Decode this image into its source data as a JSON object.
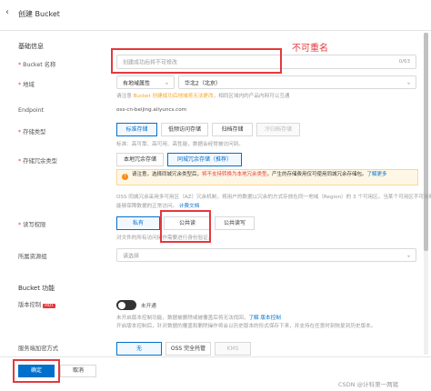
{
  "header": {
    "title": "创建 Bucket"
  },
  "basic_info": {
    "section_title": "基础信息"
  },
  "bucket_name": {
    "label": "Bucket 名称",
    "placeholder": "创建成功后将不可修改",
    "counter": "0/63"
  },
  "annotation": {
    "text": "不可重名"
  },
  "region": {
    "label": "地域",
    "type_value": "有地域属性",
    "region_value": "华北2（北京）",
    "hint_prefix": "请注意 ",
    "hint_orange": "Bucket 创建成功后地域将无法更改",
    "hint_suffix": "，相同区域内的产品内网可以互通"
  },
  "endpoint": {
    "label": "Endpoint",
    "value": "oss-cn-beijing.aliyuncs.com"
  },
  "storage_type": {
    "label": "存储类型",
    "options": [
      "标准存储",
      "低频访问存储",
      "归档存储",
      "冷归档存储"
    ],
    "hint": "标准：高可靠、高可用、高性能，数据会经常被访问到。"
  },
  "redundancy": {
    "label": "存储冗余类型",
    "options": [
      "本地冗余存储",
      "同城冗余存储（推荐）"
    ],
    "warning_prefix": "请注意，选择同城冗余类型后，",
    "warning_red": "将不支持转换为本地冗余类型",
    "warning_suffix": "。产生的存储费用仅可使用同城冗余存储包。",
    "warning_link": "了解更多",
    "hint_line1": "OSS 同城冗余采用多可用区（AZ）冗余机制，将用户的数据以冗余的方式存放在同一地域（Region）的 3 个可用区。当某个可用区不可用时，仍然",
    "hint_line2": "能够保障数据的正常访问。",
    "hint_link": "计费文档"
  },
  "acl": {
    "label": "读写权限",
    "options": [
      "私有",
      "公共读",
      "公共读写"
    ],
    "hint": "对文件的所有访问操作需要进行身份验证。"
  },
  "resource_group": {
    "label": "所属资源组",
    "placeholder": "请选择"
  },
  "bucket_features": {
    "section_title": "Bucket 功能"
  },
  "versioning": {
    "label": "版本控制",
    "badge": "HOT",
    "status": "未开通",
    "hint1_prefix": "未开启版本控制功能，数据被删除或被覆盖后将无法找回，",
    "hint1_link": "了解 版本控制",
    "hint2": "开启版本控制后，针对数据的覆盖和删除操作将会以历史版本的形式保存下来，并支持在任意时刻恢复到历史版本。"
  },
  "encryption": {
    "label": "服务端加密方式",
    "options": [
      "无",
      "OSS 完全托管",
      "KMS"
    ]
  },
  "footer": {
    "confirm": "确定",
    "cancel": "取消"
  },
  "watermark": {
    "text": "CSDN @计科第一两猪"
  },
  "colors": {
    "primary": "#0070cc",
    "annotation": "#e4393c",
    "warning": "#fa8c16"
  }
}
